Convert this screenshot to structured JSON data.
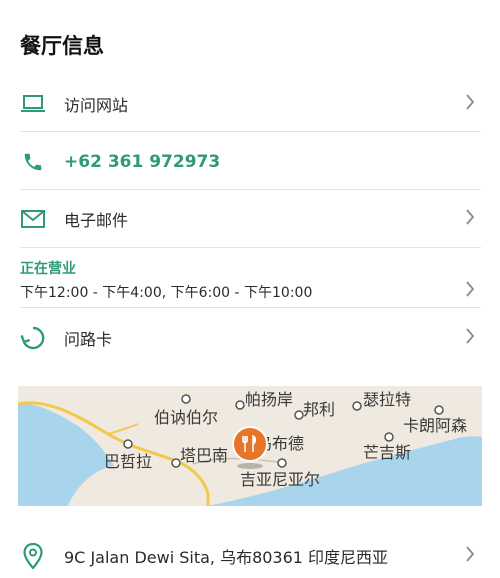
{
  "section_title": "餐厅信息",
  "rows": {
    "website": {
      "label": "访问网站",
      "icon": "laptop-icon"
    },
    "phone": {
      "label": "+62 361 972973",
      "icon": "phone-icon"
    },
    "email": {
      "label": "电子邮件",
      "icon": "mail-icon"
    },
    "hours": {
      "status": "正在营业",
      "text": "下午12:00 - 下午4:00, 下午6:00 - 下午10:00"
    },
    "directions": {
      "label": "问路卡",
      "icon": "directions-icon"
    },
    "address": {
      "label": "9C Jalan Dewi Sita, 乌布80361 印度尼西亚",
      "icon": "location-pin-icon"
    }
  },
  "map": {
    "places": [
      "帕扬岸",
      "伯讷伯尔",
      "邦利",
      "瑟拉特",
      "卡朗阿森",
      "巴哲拉",
      "塔巴南",
      "乌布德",
      "芒吉斯",
      "吉亚尼亚尔"
    ]
  },
  "colors": {
    "accent": "#2e9b72",
    "pin": "#e8742a",
    "sea": "#a8d4ec",
    "road": "#f2c94c"
  }
}
